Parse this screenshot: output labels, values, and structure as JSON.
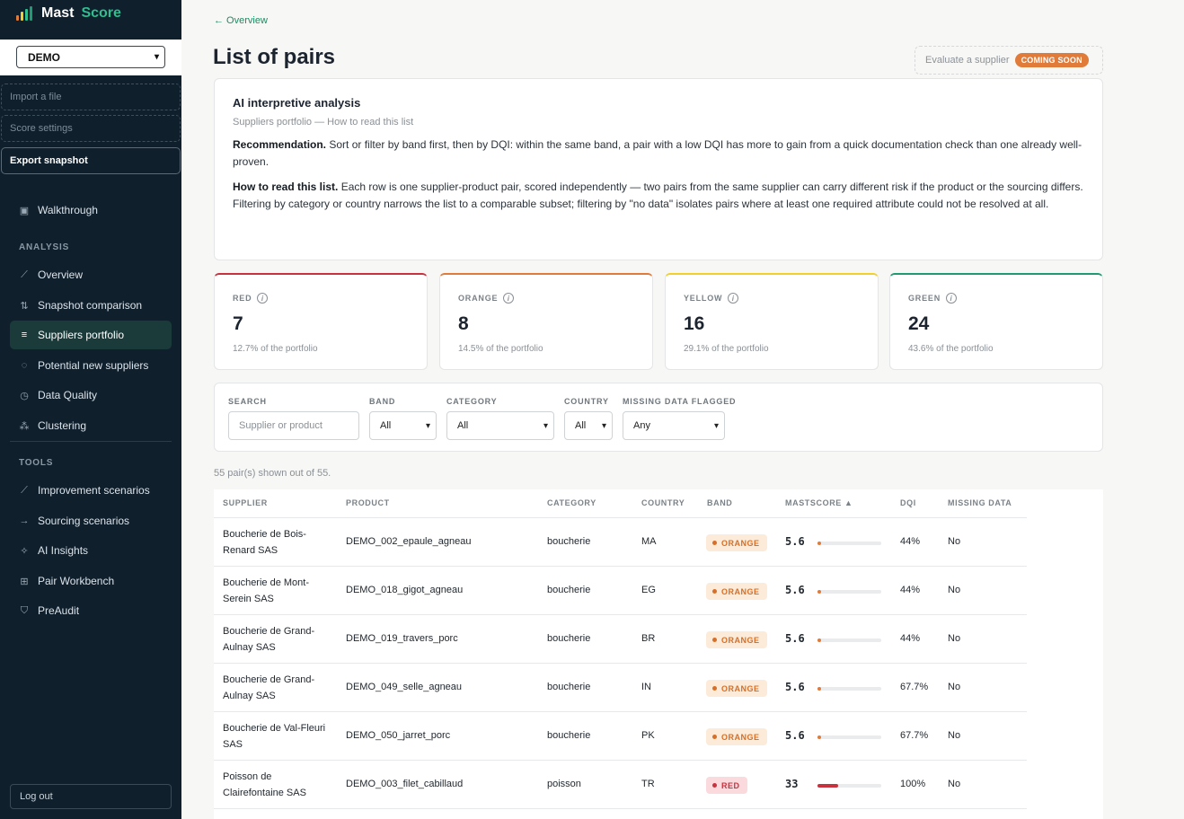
{
  "brand": {
    "name_part1": "Mast",
    "name_part2": "Score"
  },
  "workspace": {
    "selected": "DEMO"
  },
  "sidebar": {
    "import_label": "Import a file",
    "settings_label": "Score settings",
    "export_label": "Export snapshot",
    "walkthrough_label": "Walkthrough",
    "analysis_section": "ANALYSIS",
    "analysis_items": [
      {
        "label": "Overview",
        "icon": "chart-line-icon"
      },
      {
        "label": "Snapshot comparison",
        "icon": "compare-arrows-icon"
      },
      {
        "label": "Suppliers portfolio",
        "icon": "list-icon",
        "active": true
      },
      {
        "label": "Potential new suppliers",
        "icon": "target-icon"
      },
      {
        "label": "Data Quality",
        "icon": "clock-icon"
      },
      {
        "label": "Clustering",
        "icon": "cluster-icon"
      }
    ],
    "tools_section": "TOOLS",
    "tools_items": [
      {
        "label": "Improvement scenarios",
        "icon": "trend-up-icon"
      },
      {
        "label": "Sourcing scenarios",
        "icon": "arrow-right-icon"
      },
      {
        "label": "AI Insights",
        "icon": "sparkle-icon"
      },
      {
        "label": "Pair Workbench",
        "icon": "workbench-icon"
      },
      {
        "label": "PreAudit",
        "icon": "shield-check-icon"
      }
    ],
    "logout_label": "Log out"
  },
  "header": {
    "back_link": "← Overview",
    "page_title": "List of pairs",
    "evaluate_label": "Evaluate a supplier",
    "coming_soon": "COMING SOON"
  },
  "ai_card": {
    "title": "AI interpretive analysis",
    "subtitle": "Suppliers portfolio — How to read this list",
    "rec_label": "Recommendation.",
    "rec_text": " Sort or filter by band first, then by DQI: within the same band, a pair with a low DQI has more to gain from a quick documentation check than one already well-proven.",
    "how_label": "How to read this list.",
    "how_text": " Each row is one supplier-product pair, scored independently — two pairs from the same supplier can carry different risk if the product or the sourcing differs. Filtering by category or country narrows the list to a comparable subset; filtering by \"no data\" isolates pairs where at least one required attribute could not be resolved at all."
  },
  "bands": [
    {
      "label": "RED",
      "count": "7",
      "pct_text": "12.7% of the portfolio",
      "color": "#c8323e"
    },
    {
      "label": "ORANGE",
      "count": "8",
      "pct_text": "14.5% of the portfolio",
      "color": "#e07b39"
    },
    {
      "label": "YELLOW",
      "count": "16",
      "pct_text": "29.1% of the portfolio",
      "color": "#f2cf2b"
    },
    {
      "label": "GREEN",
      "count": "24",
      "pct_text": "43.6% of the portfolio",
      "color": "#1f9a73"
    }
  ],
  "filters": {
    "search_label": "SEARCH",
    "search_placeholder": "Supplier or product",
    "band_label": "BAND",
    "band_value": "All",
    "category_label": "CATEGORY",
    "category_value": "All",
    "country_label": "COUNTRY",
    "country_value": "All",
    "missing_label": "MISSING DATA FLAGGED",
    "missing_value": "Any"
  },
  "count_text": "55 pair(s) shown out of 55.",
  "table": {
    "headers": {
      "supplier": "SUPPLIER",
      "product": "PRODUCT",
      "category": "CATEGORY",
      "country": "COUNTRY",
      "band": "BAND",
      "mastscore": "MASTSCORE ▲",
      "dqi": "DQI",
      "missing": "MISSING DATA"
    },
    "rows": [
      {
        "supplier": "Boucherie de Bois-Renard SAS",
        "product": "DEMO_002_epaule_agneau",
        "category": "boucherie",
        "country": "MA",
        "band": "ORANGE",
        "score": "5.6",
        "score_fraction": 0.056,
        "dqi": "44%",
        "missing": "No"
      },
      {
        "supplier": "Boucherie de Mont-Serein SAS",
        "product": "DEMO_018_gigot_agneau",
        "category": "boucherie",
        "country": "EG",
        "band": "ORANGE",
        "score": "5.6",
        "score_fraction": 0.056,
        "dqi": "44%",
        "missing": "No"
      },
      {
        "supplier": "Boucherie de Grand-Aulnay SAS",
        "product": "DEMO_019_travers_porc",
        "category": "boucherie",
        "country": "BR",
        "band": "ORANGE",
        "score": "5.6",
        "score_fraction": 0.056,
        "dqi": "44%",
        "missing": "No"
      },
      {
        "supplier": "Boucherie de Grand-Aulnay SAS",
        "product": "DEMO_049_selle_agneau",
        "category": "boucherie",
        "country": "IN",
        "band": "ORANGE",
        "score": "5.6",
        "score_fraction": 0.056,
        "dqi": "67.7%",
        "missing": "No"
      },
      {
        "supplier": "Boucherie de Val-Fleuri SAS",
        "product": "DEMO_050_jarret_porc",
        "category": "boucherie",
        "country": "PK",
        "band": "ORANGE",
        "score": "5.6",
        "score_fraction": 0.056,
        "dqi": "67.7%",
        "missing": "No"
      },
      {
        "supplier": "Poisson de Clairefontaine SAS",
        "product": "DEMO_003_filet_cabillaud",
        "category": "poisson",
        "country": "TR",
        "band": "RED",
        "score": "33",
        "score_fraction": 0.33,
        "dqi": "100%",
        "missing": "No"
      }
    ]
  },
  "colors": {
    "orange": "#e07b39",
    "red": "#c8323e",
    "accent": "#1f8a63"
  }
}
